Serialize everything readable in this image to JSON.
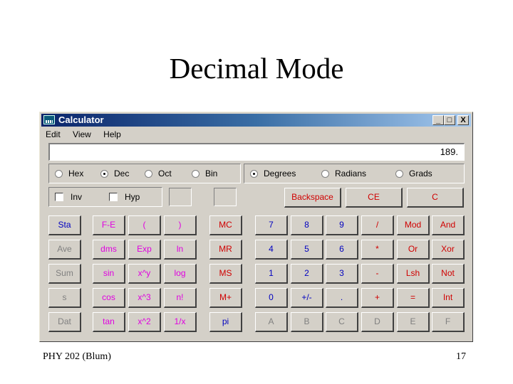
{
  "slide": {
    "title": "Decimal Mode",
    "footer_left": "PHY 202 (Blum)",
    "page_number": "17"
  },
  "window": {
    "title": "Calculator",
    "minimize": "_",
    "maximize": "□",
    "close": "X"
  },
  "menu": [
    "Edit",
    "View",
    "Help"
  ],
  "display": {
    "value": "189."
  },
  "base": [
    {
      "label": "Hex",
      "checked": false
    },
    {
      "label": "Dec",
      "checked": true
    },
    {
      "label": "Oct",
      "checked": false
    },
    {
      "label": "Bin",
      "checked": false
    }
  ],
  "angle": [
    {
      "label": "Degrees",
      "checked": true
    },
    {
      "label": "Radians",
      "checked": false
    },
    {
      "label": "Grads",
      "checked": false
    }
  ],
  "checks": [
    {
      "label": "Inv",
      "checked": false
    },
    {
      "label": "Hyp",
      "checked": false
    }
  ],
  "edit_buttons": {
    "backspace": "Backspace",
    "ce": "CE",
    "c": "C"
  },
  "rows": [
    [
      "Sta",
      "F-E",
      "(",
      ")",
      "MC",
      "7",
      "8",
      "9",
      "/",
      "Mod",
      "And"
    ],
    [
      "Ave",
      "dms",
      "Exp",
      "ln",
      "MR",
      "4",
      "5",
      "6",
      "*",
      "Or",
      "Xor"
    ],
    [
      "Sum",
      "sin",
      "x^y",
      "log",
      "MS",
      "1",
      "2",
      "3",
      "-",
      "Lsh",
      "Not"
    ],
    [
      "s",
      "cos",
      "x^3",
      "n!",
      "M+",
      "0",
      "+/-",
      ".",
      "+",
      "=",
      "Int"
    ],
    [
      "Dat",
      "tan",
      "x^2",
      "1/x",
      "pi",
      "A",
      "B",
      "C",
      "D",
      "E",
      "F"
    ]
  ]
}
